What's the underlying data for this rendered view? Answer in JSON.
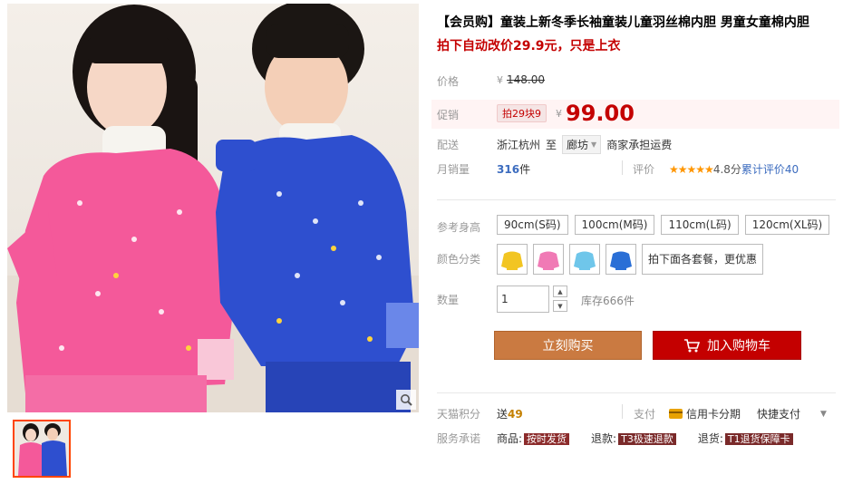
{
  "product": {
    "title": "【会员购】童装上新冬季长袖童装儿童羽丝棉内胆 男童女童棉内胆",
    "subtitle": "拍下自动改价29.9元，只是上衣"
  },
  "price": {
    "label": "价格",
    "currency": "¥",
    "original": "148.00"
  },
  "promo": {
    "label": "促销",
    "tag": "拍29块9",
    "currency": "¥",
    "price": "99.00"
  },
  "delivery": {
    "label": "配送",
    "origin": "浙江杭州",
    "to": "至",
    "destination": "廊坊",
    "shipping": "商家承担运费"
  },
  "sales": {
    "label": "月销量",
    "count": "316",
    "unit": "件",
    "review_label": "评价",
    "stars": "★★★★★",
    "score": "4.8分",
    "review_text": "累计评价",
    "review_count": "40"
  },
  "sizes": {
    "label": "参考身高",
    "options": [
      "90cm(S码)",
      "100cm(M码)",
      "110cm(L码)",
      "120cm(XL码)"
    ]
  },
  "colors": {
    "label": "颜色分类",
    "swatches": [
      {
        "name": "yellow",
        "color": "#f2c522"
      },
      {
        "name": "pink",
        "color": "#f07ab5"
      },
      {
        "name": "light-blue",
        "color": "#6fc6ea"
      },
      {
        "name": "blue",
        "color": "#2a6fd6"
      }
    ],
    "text_option": "拍下面各套餐，更优惠"
  },
  "quantity": {
    "label": "数量",
    "value": "1",
    "stock": "库存666件"
  },
  "buttons": {
    "buy": "立刻购买",
    "cart": "加入购物车"
  },
  "points": {
    "label": "天猫积分",
    "prefix": "送",
    "value": "49"
  },
  "payment": {
    "label": "支付",
    "installment": "信用卡分期",
    "quick": "快捷支付"
  },
  "service": {
    "label": "服务承诺",
    "items": [
      {
        "prefix": "商品:",
        "tag": "按时发货"
      },
      {
        "prefix": "退款:",
        "tag": "T3极速退款"
      },
      {
        "prefix": "退货:",
        "tag": "T1退货保障卡"
      }
    ]
  }
}
